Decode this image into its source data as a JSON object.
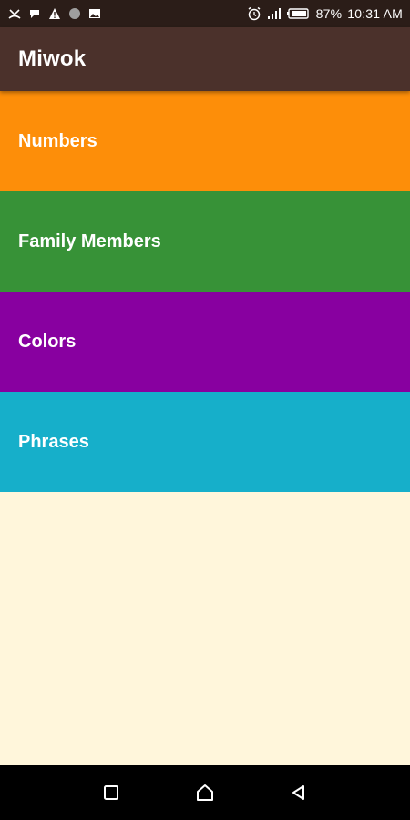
{
  "status_bar": {
    "battery": "87%",
    "time": "10:31 AM",
    "left_icons": [
      "missed-call-icon",
      "chat-bubble-icon",
      "warning-icon",
      "dot-icon",
      "image-icon"
    ],
    "right_icons": [
      "alarm-icon",
      "signal-icon",
      "battery-icon"
    ]
  },
  "app_bar": {
    "title": "Miwok"
  },
  "categories": [
    {
      "label": "Numbers",
      "color": "#FD8E09"
    },
    {
      "label": "Family Members",
      "color": "#379237"
    },
    {
      "label": "Colors",
      "color": "#8800A0"
    },
    {
      "label": "Phrases",
      "color": "#16AFCA"
    }
  ],
  "colors": {
    "background": "#FFF6DB",
    "app_bar": "#4B312B",
    "status_bar": "#2B1D18",
    "nav_bar": "#000000"
  },
  "nav_bar": {
    "buttons": [
      "recents-icon",
      "home-icon",
      "back-icon"
    ]
  }
}
